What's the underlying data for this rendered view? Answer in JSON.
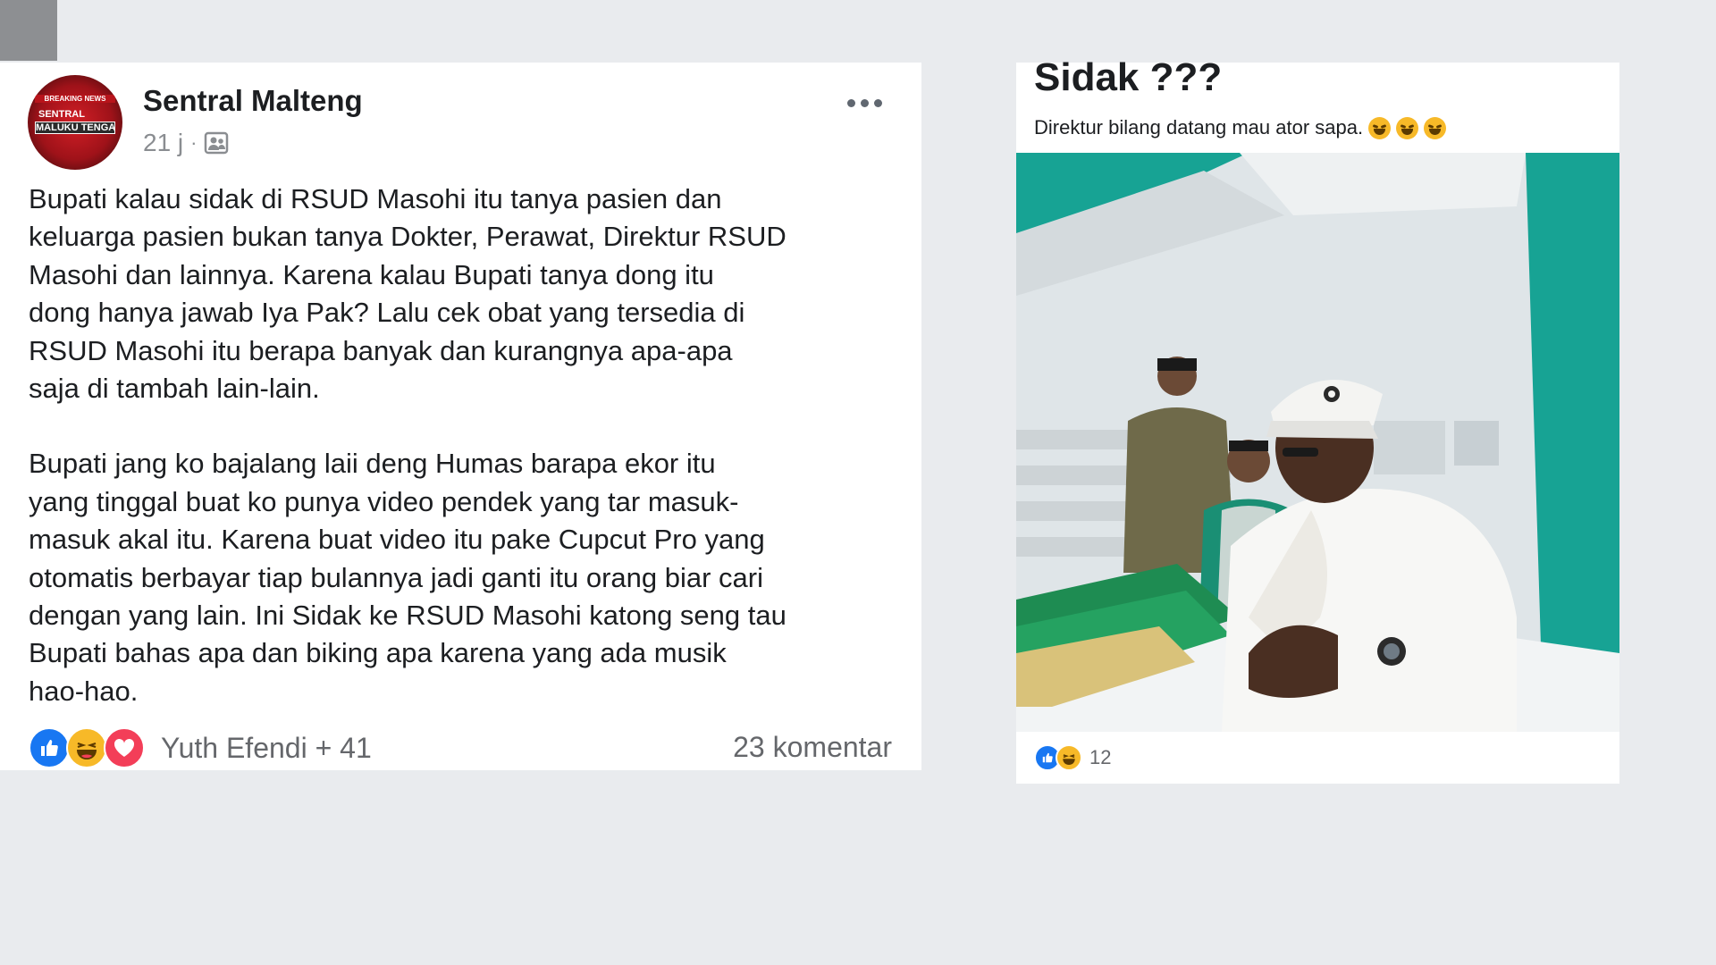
{
  "left_post": {
    "page_name": "Sentral Malteng",
    "avatar_lines": [
      "BREAKING NEWS",
      "SENTRAL",
      "MALUKU TENGAH"
    ],
    "time": "21 j",
    "separator": "·",
    "audience_icon": "friends-audience-icon",
    "more_icon": "more-options-icon",
    "paragraphs": [
      "Bupati kalau sidak di RSUD Masohi itu tanya pasien dan\nkeluarga pasien bukan tanya Dokter, Perawat, Direktur RSUD\nMasohi dan lainnya. Karena kalau Bupati tanya dong itu\ndong hanya jawab Iya Pak? Lalu cek obat yang tersedia di\nRSUD Masohi itu berapa banyak dan kurangnya apa-apa\nsaja di tambah lain-lain.",
      "Bupati jang ko bajalang laii deng Humas barapa ekor itu\nyang tinggal buat ko punya video pendek yang tar masuk-\nmasuk akal itu. Karena buat video itu pake Cupcut Pro yang\notomatis berbayar tiap bulannya jadi ganti itu orang biar cari\ndengan yang lain. Ini Sidak ke RSUD Masohi katong seng tau\nBupati bahas apa dan biking apa karena yang ada musik\nhao-hao."
    ],
    "reactions": [
      "like-icon",
      "haha-icon",
      "love-icon"
    ],
    "reaction_names": "Yuth Efendi + 41",
    "comments": "23 komentar"
  },
  "right_post": {
    "title": "Sidak ???",
    "caption": "Direktur bilang datang mau ator sapa.",
    "caption_emojis": [
      "rofl-emoji",
      "rofl-emoji",
      "rofl-emoji"
    ],
    "reactions": [
      "like-icon",
      "haha-icon"
    ],
    "reaction_count": "12"
  },
  "colors": {
    "background": "#e9ebee",
    "like_blue": "#1877f2",
    "haha_yellow": "#f7b928",
    "love_red": "#f33e58",
    "secondary_text": "#65676b",
    "wall_teal": "#17a394"
  }
}
